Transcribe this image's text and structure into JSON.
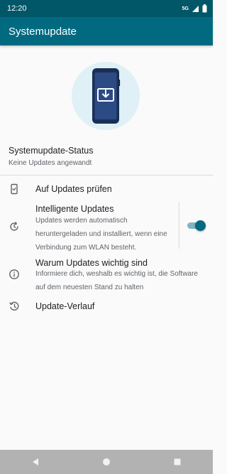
{
  "status_bar": {
    "time": "12:20",
    "network": "5G",
    "icons": [
      "signal-icon",
      "battery-icon"
    ]
  },
  "app_bar": {
    "title": "Systemupdate"
  },
  "update_status": {
    "title": "Systemupdate-Status",
    "subtitle": "Keine Updates angewandt"
  },
  "list": {
    "items": [
      {
        "icon": "phone-check-icon",
        "title": "Auf Updates prüfen"
      },
      {
        "icon": "auto-update-icon",
        "title": "Intelligente Updates",
        "description_lines": [
          "Updates werden automatisch",
          "heruntergeladen und installiert, wenn eine",
          "Verbindung zum WLAN besteht."
        ],
        "toggle_on": true
      },
      {
        "icon": "info-icon",
        "title": "Warum Updates wichtig sind",
        "description_lines": [
          "Informiere dich, weshalb es wichtig ist, die Software",
          "auf dem neuesten Stand zu halten"
        ]
      },
      {
        "icon": "history-icon",
        "title": "Update-Verlauf"
      }
    ]
  },
  "nav_bar": {
    "buttons": [
      "back-icon",
      "home-icon",
      "recents-icon"
    ]
  },
  "colors": {
    "status_bar": "#015667",
    "app_bar": "#016a80",
    "accent": "#016a80",
    "hero_circle": "#dff0f6",
    "nav_bar": "#b2b2b2"
  }
}
